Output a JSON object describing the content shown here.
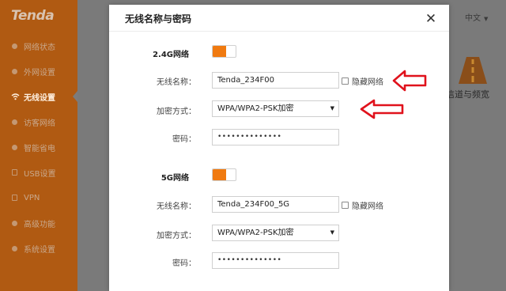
{
  "brand": {
    "logo": "Tenda"
  },
  "sidebar": {
    "items": [
      {
        "label": "网络状态",
        "icon": "dashboard-icon"
      },
      {
        "label": "外网设置",
        "icon": "globe-icon"
      },
      {
        "label": "无线设置",
        "icon": "wifi-icon",
        "active": true
      },
      {
        "label": "访客网络",
        "icon": "guest-icon"
      },
      {
        "label": "智能省电",
        "icon": "power-icon"
      },
      {
        "label": "USB设置",
        "icon": "usb-icon"
      },
      {
        "label": "VPN",
        "icon": "vpn-icon"
      },
      {
        "label": "高级功能",
        "icon": "tools-icon"
      },
      {
        "label": "系统设置",
        "icon": "settings-icon"
      }
    ]
  },
  "header": {
    "language": "中文"
  },
  "background_page": {
    "channel_label": "信道与频宽"
  },
  "modal": {
    "title": "无线名称与密码",
    "band_24g": {
      "section_label": "2.4G网络",
      "enabled": true,
      "ssid_label": "无线名称：",
      "ssid_value": "Tenda_234F00",
      "hide_label": "隐藏网络",
      "hide_checked": false,
      "security_label": "加密方式：",
      "security_value": "WPA/WPA2-PSK加密",
      "password_label": "密码：",
      "password_value": "••••••••••••••"
    },
    "band_5g": {
      "section_label": "5G网络",
      "enabled": true,
      "ssid_label": "无线名称：",
      "ssid_value": "Tenda_234F00_5G",
      "hide_label": "隐藏网络",
      "hide_checked": false,
      "security_label": "加密方式：",
      "security_value": "WPA/WPA2-PSK加密",
      "password_label": "密码：",
      "password_value": "••••••••••••••"
    }
  },
  "colors": {
    "accent": "#f07a10",
    "sidebar": "#b05a12",
    "annotation": "#e0121c"
  }
}
